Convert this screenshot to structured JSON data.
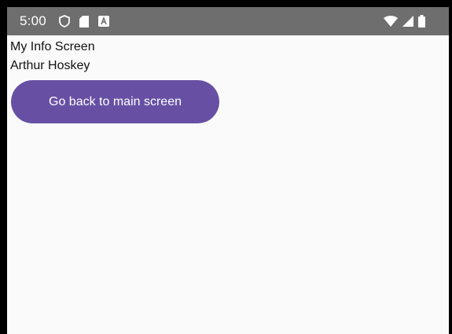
{
  "status_bar": {
    "time": "5:00",
    "left_icons": [
      "shield-icon",
      "sd-card-icon",
      "a-notification-icon"
    ],
    "right_icons": [
      "wifi-icon",
      "signal-icon",
      "battery-icon"
    ]
  },
  "screen": {
    "title": "My Info Screen",
    "name": "Arthur Hoskey",
    "back_button_label": "Go back to main screen"
  },
  "colors": {
    "status_bar_bg": "#6e6e6e",
    "button_bg": "#6750a4",
    "button_text": "#ffffff",
    "screen_bg": "#fafafa"
  }
}
